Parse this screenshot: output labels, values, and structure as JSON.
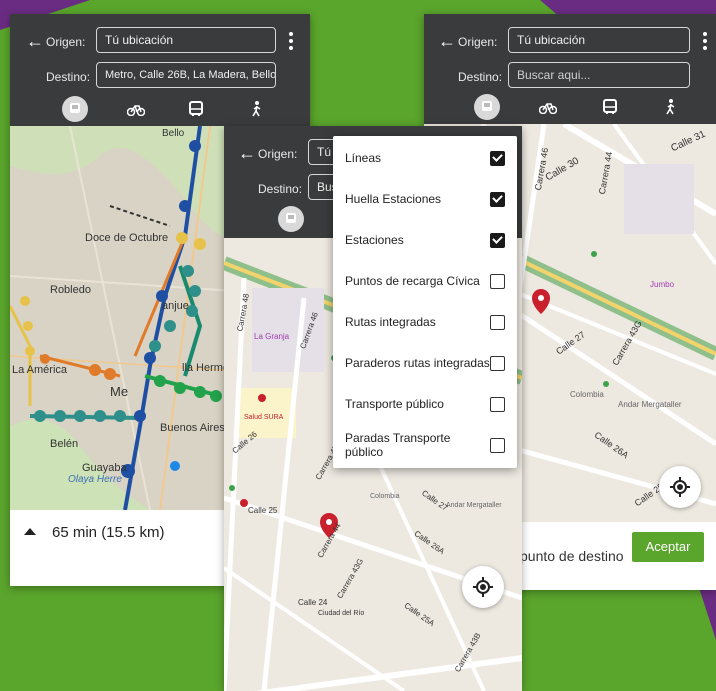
{
  "colors": {
    "background_green": "#5aa52c",
    "accent_purple": "#6a2c83",
    "header_dark": "#3a3b3c",
    "accept_green": "#5aa52c",
    "metro_blue": "#1f4fa3",
    "metro_green": "#1a8a6e",
    "map_pin_red": "#c8202c"
  },
  "screen1": {
    "origin_label": "Origen:",
    "origin_value": "Tú ubicación",
    "destination_label": "Destino:",
    "destination_value": "Metro, Calle 26B, La Madera, Bello.",
    "modes": [
      "metro-icon",
      "bicycle-icon",
      "bus-icon",
      "walk-icon"
    ],
    "map_labels": [
      "Bello",
      "Doce de Octubre",
      "Robledo",
      "anjue",
      "La América",
      "Me",
      "lla Hermo",
      "Buenos Aires",
      "Belén",
      "Guayaba",
      "Olaya Herre"
    ],
    "route_summary": "65 min (15.5 km)"
  },
  "screen2": {
    "origin_label": "Origen:",
    "origin_value": "Tú u",
    "destination_label": "Destino:",
    "destination_value": "Bus",
    "menu": [
      {
        "label": "Líneas",
        "checked": true
      },
      {
        "label": "Huella Estaciones",
        "checked": true
      },
      {
        "label": "Estaciones",
        "checked": true
      },
      {
        "label": "Puntos de recarga Cívica",
        "checked": false
      },
      {
        "label": "Rutas integradas",
        "checked": false
      },
      {
        "label": "Paraderos rutas integradas",
        "checked": false
      },
      {
        "label": "Transporte público",
        "checked": false
      },
      {
        "label": "Paradas Transporte público",
        "checked": false
      }
    ],
    "map_labels": [
      "La Granja",
      "Salud SURA",
      "Carrera 48",
      "Carrera 46",
      "Calle 26",
      "Calle 25",
      "Carrera 45",
      "Carrera 44",
      "Carrera 43G",
      "Colombia",
      "Andar Mergataller",
      "Calle 27",
      "Calle 26A",
      "Calle 25A",
      "Calle 24",
      "Ciudad del Río",
      "Carrera 43B"
    ]
  },
  "screen3": {
    "origin_label": "Origen:",
    "origin_value": "Tú ubicación",
    "destination_label": "Destino:",
    "destination_placeholder": "Buscar aqui...",
    "map_labels": [
      "Calle 30",
      "Carrera 46",
      "Carrera 44",
      "Calle 31",
      "Jumbo",
      "Colombia",
      "Andar Mergataller",
      "Calle 27",
      "Calle 26A",
      "Calle 25A",
      "Carrera 43G"
    ],
    "destination_prompt": "punto de destino",
    "accept_label": "Aceptar"
  }
}
